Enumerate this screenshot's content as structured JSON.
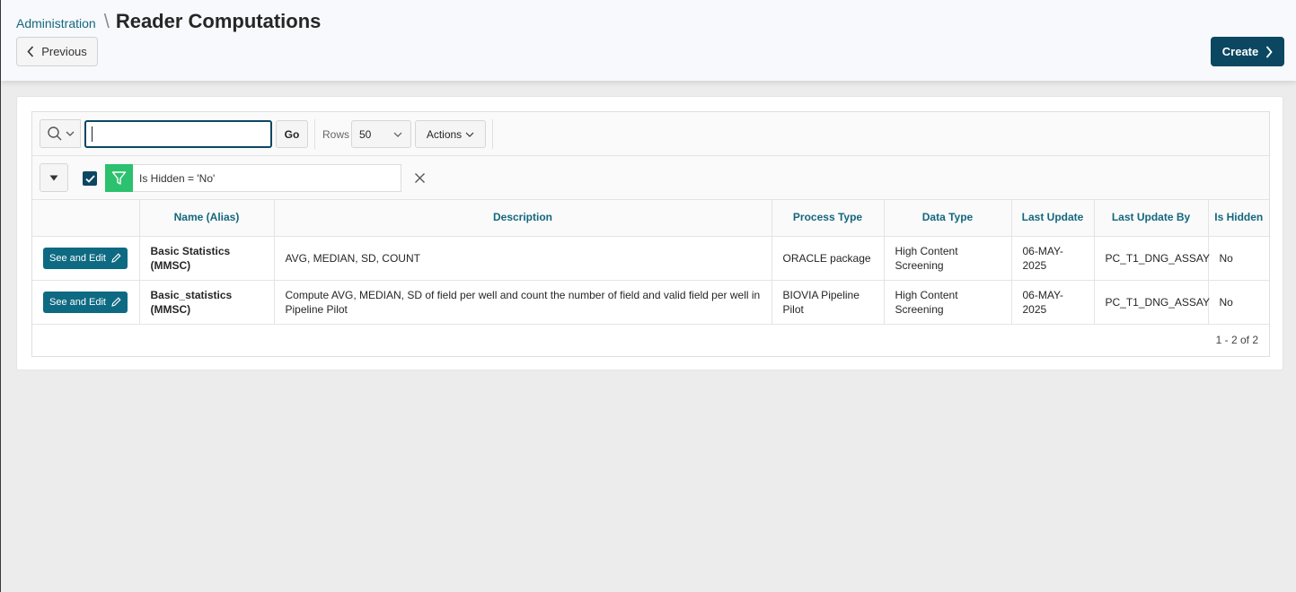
{
  "breadcrumb": {
    "parent": "Administration",
    "separator": "\\",
    "title": "Reader Computations"
  },
  "header": {
    "previous_label": "Previous",
    "create_label": "Create"
  },
  "toolbar": {
    "search_value": "",
    "go_label": "Go",
    "rows_label": "Rows",
    "rows_value": "50",
    "actions_label": "Actions"
  },
  "filter": {
    "enabled": true,
    "text": "Is Hidden = 'No'"
  },
  "table": {
    "columns": [
      "",
      "Name (Alias)",
      "Description",
      "Process Type",
      "Data Type",
      "Last Update",
      "Last Update By",
      "Is Hidden"
    ],
    "edit_label": "See and Edit",
    "rows": [
      {
        "name": "Basic Statistics (MMSC)",
        "description": "AVG, MEDIAN, SD, COUNT",
        "process_type": "ORACLE package",
        "data_type": "High Content Screening",
        "last_update": "06-MAY-2025",
        "last_update_by": "PC_T1_DNG_ASSAY",
        "is_hidden": "No"
      },
      {
        "name": "Basic_statistics (MMSC)",
        "description": "Compute AVG, MEDIAN, SD of field per well and count the number of field and valid field per well in Pipeline Pilot",
        "process_type": "BIOVIA Pipeline Pilot",
        "data_type": "High Content Screening",
        "last_update": "06-MAY-2025",
        "last_update_by": "PC_T1_DNG_ASSAY",
        "is_hidden": "No"
      }
    ]
  },
  "pagination": {
    "text": "1 - 2 of 2"
  },
  "colors": {
    "primary": "#0b4761",
    "link": "#14677e",
    "filter_green": "#2bc16e",
    "edit_button": "#0e6a82"
  },
  "icons": {
    "search": "search-icon",
    "previous": "chevron-left-icon",
    "create": "chevron-right-icon",
    "filter": "funnel-icon",
    "edit": "pencil-icon",
    "remove": "close-icon"
  }
}
